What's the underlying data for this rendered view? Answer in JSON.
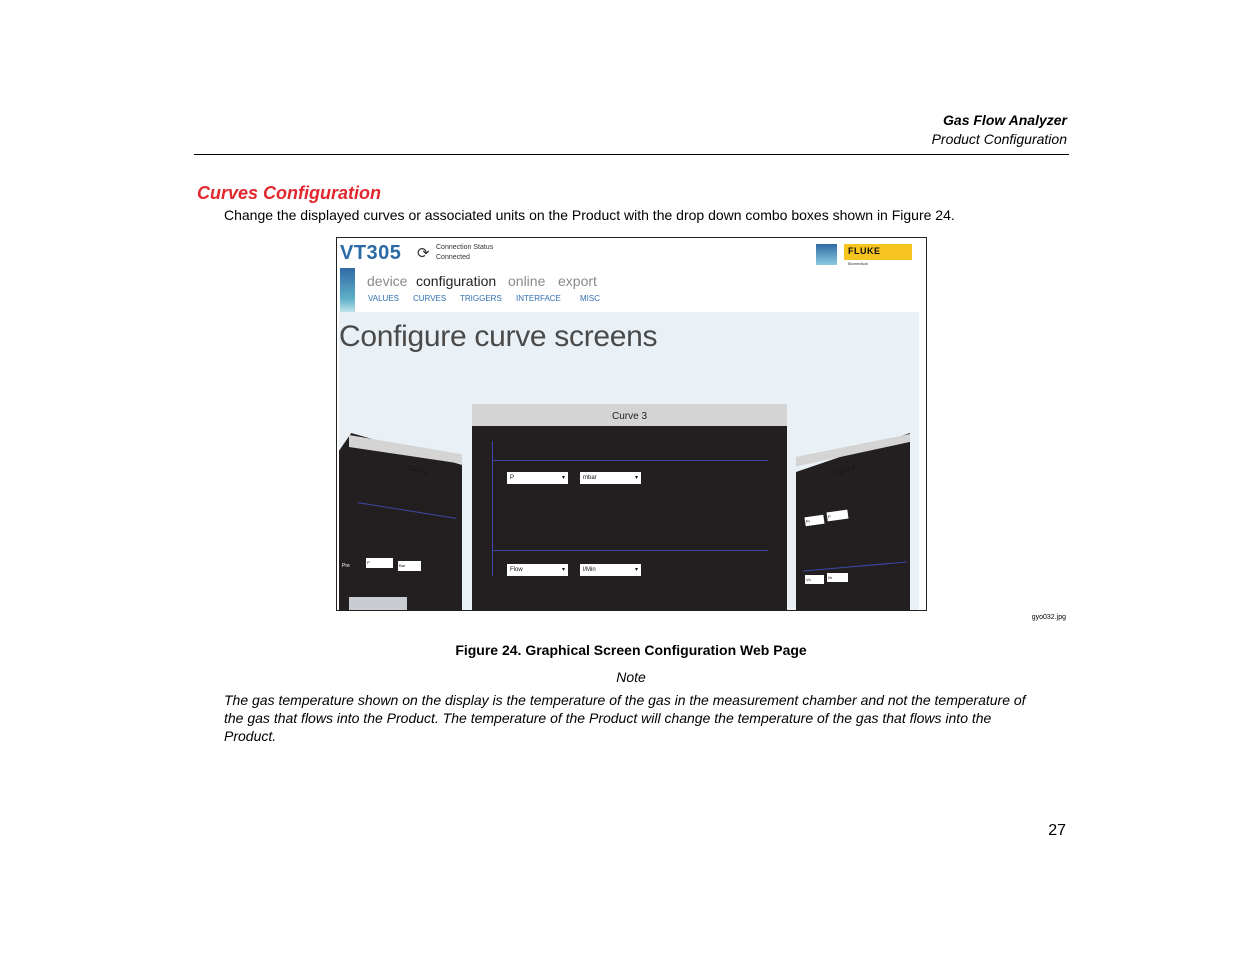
{
  "header": {
    "title": "Gas Flow Analyzer",
    "subtitle": "Product Configuration"
  },
  "section": {
    "heading": "Curves Configuration",
    "intro": "Change the displayed curves or associated units on the Product with the drop down combo boxes shown in Figure 24."
  },
  "figure": {
    "app": {
      "title": "VT305",
      "connection_label": "Connection Status",
      "connection_value": "Connected",
      "nav": [
        "device",
        "configuration",
        "online",
        "export"
      ],
      "nav_active": "configuration",
      "subnav": [
        "VALUES",
        "CURVES",
        "TRIGGERS",
        "INTERFACE",
        "MISC"
      ],
      "brand": "FLUKE",
      "brand_sub": "Biomedical",
      "page_heading": "Configure curve screens",
      "curve_center": {
        "title": "Curve 3",
        "top_param": "P",
        "top_unit": "mbar",
        "bottom_param": "Flow",
        "bottom_unit": "l/Min"
      },
      "curve_left": {
        "title": "Curve 2",
        "label": "Pre",
        "param": "P",
        "unit": "Bar"
      },
      "curve_right": {
        "title": "Curve 4",
        "label1": "Pr",
        "param1": "P",
        "label2": "Vo",
        "unit2": "l/h"
      }
    },
    "file_tag": "gyo032.jpg",
    "caption": "Figure 24. Graphical Screen Configuration Web Page"
  },
  "note": {
    "label": "Note",
    "body": "The gas temperature shown on the display is the temperature of the gas in the measurement chamber and not the temperature of the gas that flows into the Product. The temperature of the Product will change the temperature of the gas that flows into the Product."
  },
  "page_number": "27"
}
